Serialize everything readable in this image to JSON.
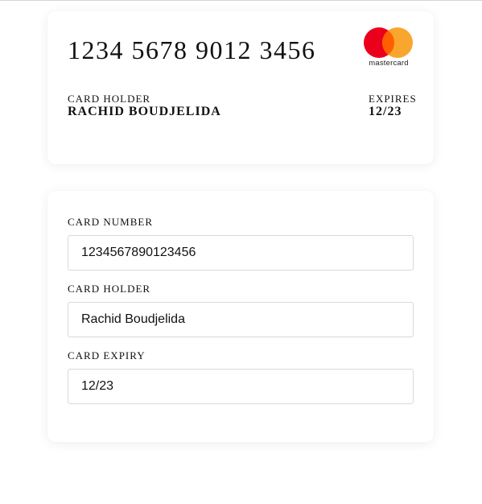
{
  "preview": {
    "card_number": "1234 5678 9012 3456",
    "brand": {
      "icon": "mastercard-logo-icon",
      "name": "mastercard",
      "colors": {
        "red": "#eb001b",
        "orange": "#f79e1b",
        "overlap": "#ff5f00"
      }
    },
    "holder_label": "CARD HOLDER",
    "holder_value": "RACHID BOUDJELIDA",
    "expires_label": "EXPIRES",
    "expires_value": "12/23"
  },
  "form": {
    "card_number": {
      "label": "CARD NUMBER",
      "value": "1234567890123456"
    },
    "card_holder": {
      "label": "CARD HOLDER",
      "value": "Rachid Boudjelida"
    },
    "card_expiry": {
      "label": "CARD EXPIRY",
      "value": "12/23"
    }
  }
}
